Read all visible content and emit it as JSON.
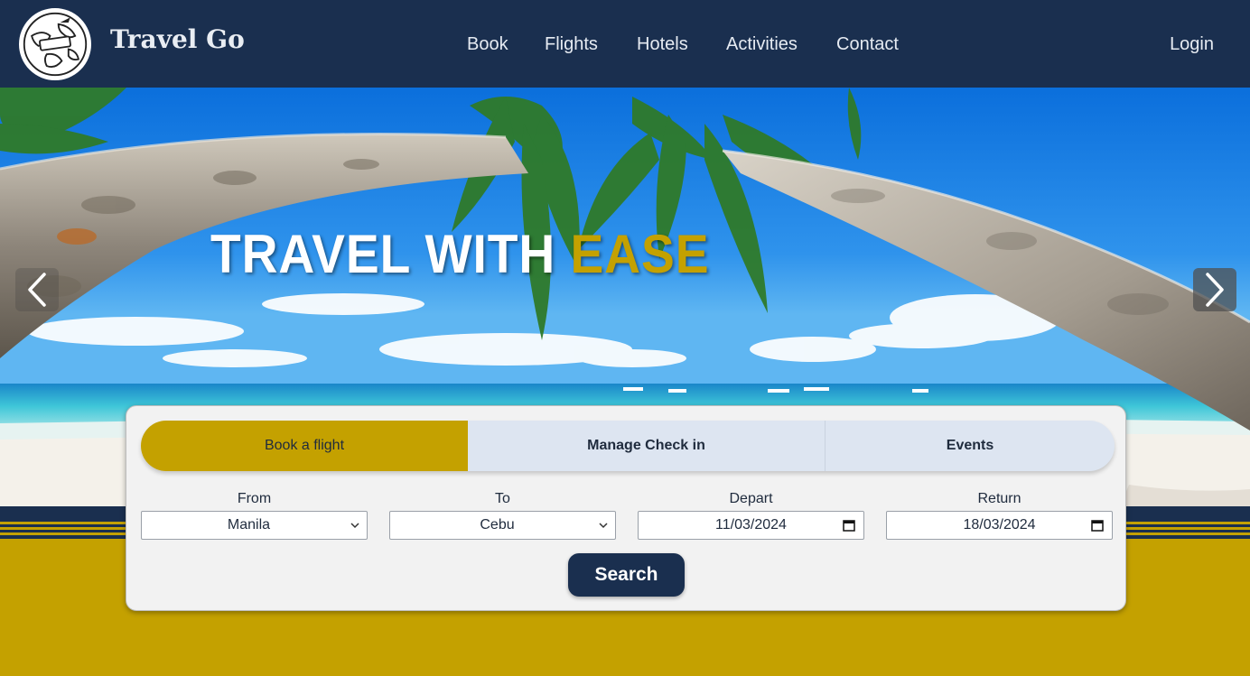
{
  "header": {
    "brand": "Travel Go",
    "logo_icon": "globe-travel-logo",
    "nav": [
      {
        "label": "Book"
      },
      {
        "label": "Flights"
      },
      {
        "label": "Hotels"
      },
      {
        "label": "Activities"
      },
      {
        "label": "Contact"
      }
    ],
    "login_label": "Login"
  },
  "hero": {
    "title_main": "TRAVEL WITH ",
    "title_accent": "EASE",
    "prev_icon": "chevron-left-icon",
    "next_icon": "chevron-right-icon"
  },
  "booking": {
    "tabs": [
      {
        "label": "Book a flight",
        "active": true
      },
      {
        "label": "Manage Check in",
        "active": false
      },
      {
        "label": "Events",
        "active": false
      }
    ],
    "fields": {
      "from": {
        "label": "From",
        "value": "Manila"
      },
      "to": {
        "label": "To",
        "value": "Cebu"
      },
      "depart": {
        "label": "Depart",
        "value": "11/03/2024"
      },
      "return": {
        "label": "Return",
        "value": "18/03/2024"
      }
    },
    "search_label": "Search"
  },
  "colors": {
    "navy": "#1a2f4f",
    "gold": "#c4a100",
    "tab_bg": "#dde5f1",
    "card_bg": "#f2f2f2"
  }
}
